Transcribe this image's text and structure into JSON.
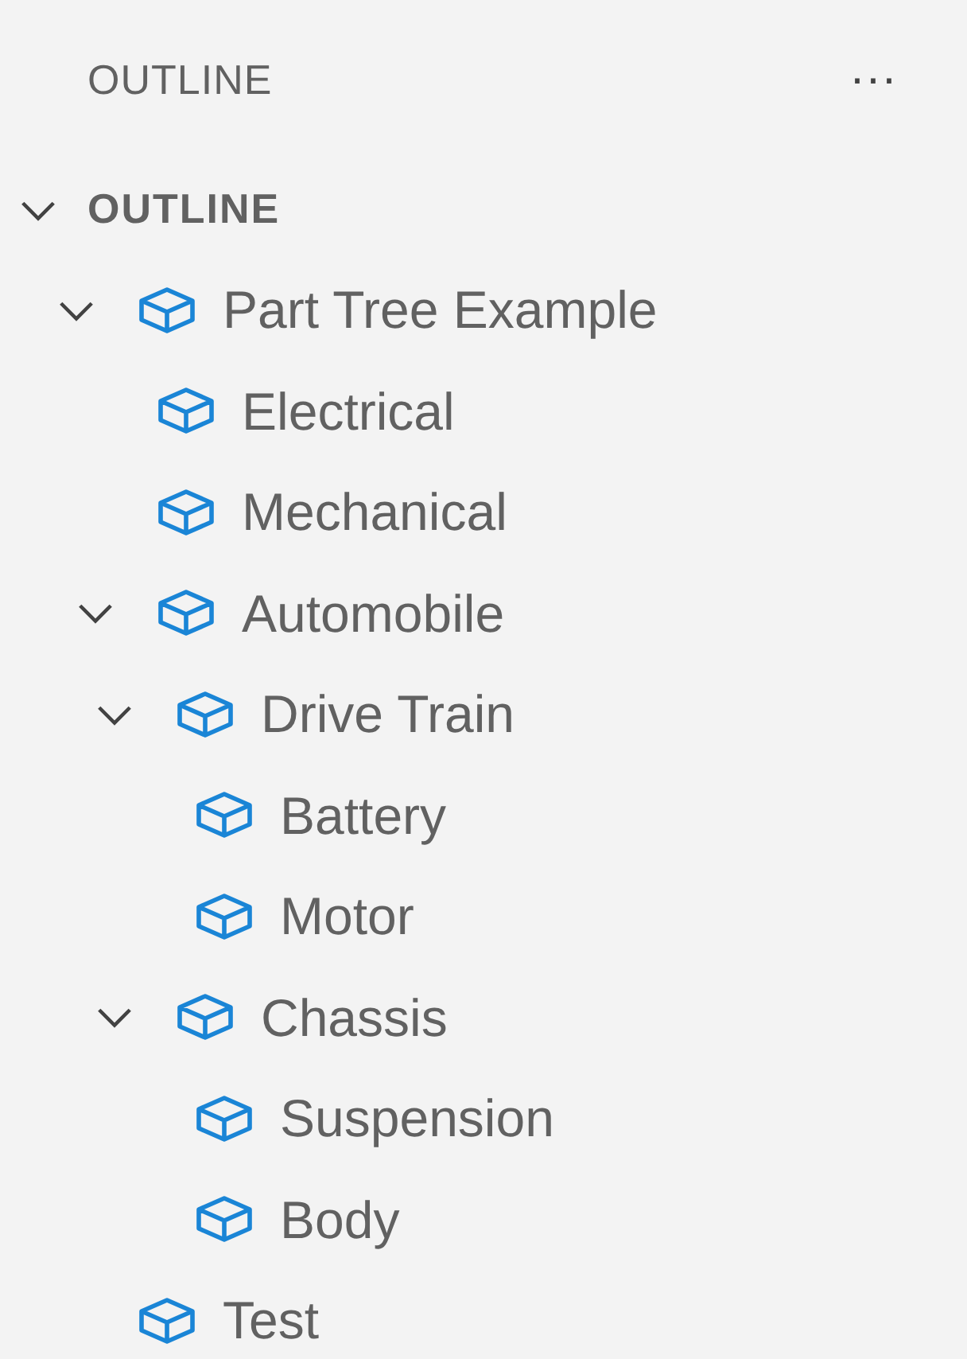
{
  "panel": {
    "title": "OUTLINE",
    "more": "···"
  },
  "section": {
    "title": "OUTLINE",
    "expanded": true
  },
  "tree": [
    {
      "label": "Part Tree Example",
      "expanded": true,
      "children": [
        {
          "label": "Electrical"
        },
        {
          "label": "Mechanical"
        },
        {
          "label": "Automobile",
          "expanded": true,
          "children": [
            {
              "label": "Drive Train",
              "expanded": true,
              "children": [
                {
                  "label": "Battery"
                },
                {
                  "label": "Motor"
                }
              ]
            },
            {
              "label": "Chassis",
              "expanded": true,
              "children": [
                {
                  "label": "Suspension"
                },
                {
                  "label": "Body"
                }
              ]
            }
          ]
        }
      ]
    },
    {
      "label": "Test"
    }
  ]
}
